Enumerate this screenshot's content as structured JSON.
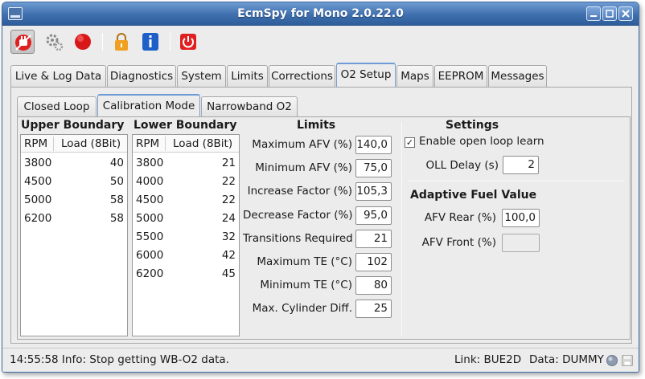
{
  "window": {
    "title": "EcmSpy for Mono 2.0.22.0"
  },
  "tabs": [
    "Live & Log Data",
    "Diagnostics",
    "System",
    "Limits",
    "Corrections",
    "O2 Setup",
    "Maps",
    "EEPROM",
    "Messages"
  ],
  "subtabs": [
    "Closed Loop",
    "Calibration Mode",
    "Narrowband O2"
  ],
  "upper_boundary": {
    "title": "Upper Boundary",
    "col_rpm": "RPM",
    "col_load": "Load (8Bit)",
    "rows": [
      {
        "rpm": "3800",
        "load": "40"
      },
      {
        "rpm": "4500",
        "load": "50"
      },
      {
        "rpm": "5000",
        "load": "58"
      },
      {
        "rpm": "6200",
        "load": "58"
      }
    ]
  },
  "lower_boundary": {
    "title": "Lower Boundary",
    "col_rpm": "RPM",
    "col_load": "Load (8Bit)",
    "rows": [
      {
        "rpm": "3800",
        "load": "21"
      },
      {
        "rpm": "4000",
        "load": "22"
      },
      {
        "rpm": "4500",
        "load": "22"
      },
      {
        "rpm": "5000",
        "load": "24"
      },
      {
        "rpm": "5500",
        "load": "32"
      },
      {
        "rpm": "6000",
        "load": "42"
      },
      {
        "rpm": "6200",
        "load": "45"
      }
    ]
  },
  "limits": {
    "title": "Limits",
    "fields": [
      {
        "label": "Maximum AFV (%)",
        "value": "140,0"
      },
      {
        "label": "Minimum AFV (%)",
        "value": "75,0"
      },
      {
        "label": "Increase Factor (%)",
        "value": "105,3"
      },
      {
        "label": "Decrease Factor (%)",
        "value": "95,0"
      },
      {
        "label": "Transitions Required",
        "value": "21"
      },
      {
        "label": "Maximum TE (°C)",
        "value": "102"
      },
      {
        "label": "Minimum TE (°C)",
        "value": "80"
      },
      {
        "label": "Max. Cylinder Diff.",
        "value": "25"
      }
    ]
  },
  "settings": {
    "title": "Settings",
    "open_loop_learn_label": "Enable open loop learn",
    "open_loop_learn_checked": true,
    "check_mark": "✓",
    "oll_delay_label": "OLL Delay (s)",
    "oll_delay_value": "2"
  },
  "adaptive": {
    "title": "Adaptive Fuel Value",
    "afv_rear_label": "AFV Rear (%)",
    "afv_rear_value": "100,0",
    "afv_front_label": "AFV Front (%)",
    "afv_front_value": ""
  },
  "status": {
    "message": "14:55:58 Info: Stop getting WB-O2 data.",
    "link": "Link: BUE2D",
    "data": "Data: DUMMY"
  },
  "toolbar_icons": [
    "connect-plug-icon",
    "settings-gears-icon",
    "stop-record-icon",
    "lock-icon",
    "info-icon",
    "power-icon"
  ],
  "colors": {
    "title_bar": "#3f6fae",
    "accent_red": "#e02020",
    "lock_orange": "#f0a020",
    "info_blue": "#1f5fc8"
  }
}
